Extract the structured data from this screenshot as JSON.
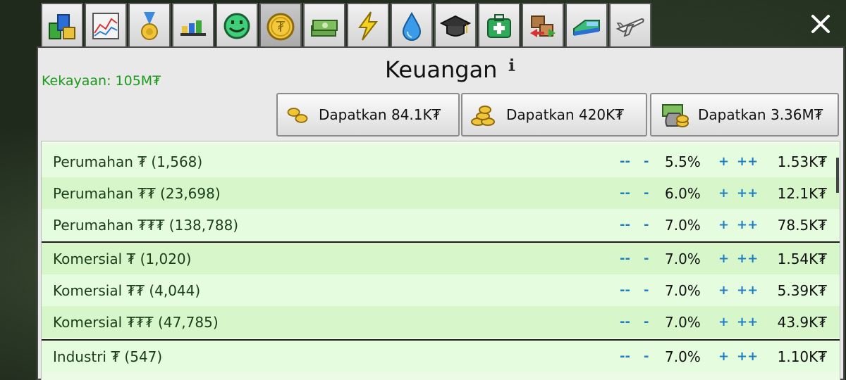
{
  "tabs": [
    {
      "icon": "buildings-icon",
      "active": false
    },
    {
      "icon": "chart-icon",
      "active": false
    },
    {
      "icon": "medal-icon",
      "active": false
    },
    {
      "icon": "bar-graph-icon",
      "active": false
    },
    {
      "icon": "smiley-icon",
      "active": false
    },
    {
      "icon": "coin-icon",
      "active": true
    },
    {
      "icon": "money-stack-icon",
      "active": false
    },
    {
      "icon": "lightning-icon",
      "active": false
    },
    {
      "icon": "water-drop-icon",
      "active": false
    },
    {
      "icon": "graduation-cap-icon",
      "active": false
    },
    {
      "icon": "medical-kit-icon",
      "active": false
    },
    {
      "icon": "export-boxes-icon",
      "active": false
    },
    {
      "icon": "train-icon",
      "active": false
    },
    {
      "icon": "airplane-icon",
      "active": false
    }
  ],
  "panel": {
    "wealth": "Kekayaan: 105M₮",
    "title": "Keuangan",
    "earn_buttons": [
      {
        "label": "Dapatkan 84.1K₮",
        "icon": "small-coins-icon"
      },
      {
        "label": "Dapatkan 420K₮",
        "icon": "coin-pile-icon"
      },
      {
        "label": "Dapatkan 3.36M₮",
        "icon": "money-bag-icon"
      }
    ]
  },
  "controls": {
    "dec2": "--",
    "dec1": "-",
    "inc1": "+",
    "inc2": "++"
  },
  "rows": [
    {
      "name": "Perumahan ₮ (1,568)",
      "rate": "5.5%",
      "income": "1.53K₮"
    },
    {
      "name": "Perumahan ₮₮ (23,698)",
      "rate": "6.0%",
      "income": "12.1K₮"
    },
    {
      "name": "Perumahan ₮₮₮ (138,788)",
      "rate": "7.0%",
      "income": "78.5K₮"
    },
    {
      "name": "Komersial ₮ (1,020)",
      "rate": "7.0%",
      "income": "1.54K₮"
    },
    {
      "name": "Komersial ₮₮ (4,044)",
      "rate": "7.0%",
      "income": "5.39K₮"
    },
    {
      "name": "Komersial ₮₮₮ (47,785)",
      "rate": "7.0%",
      "income": "43.9K₮"
    },
    {
      "name": "Industri ₮ (547)",
      "rate": "7.0%",
      "income": "1.10K₮"
    }
  ],
  "colors": {
    "wealth": "#1c9a1c",
    "controls": "#1d7fc9",
    "row_light": "#e5fcde",
    "row_dark": "#d7f7cb"
  }
}
